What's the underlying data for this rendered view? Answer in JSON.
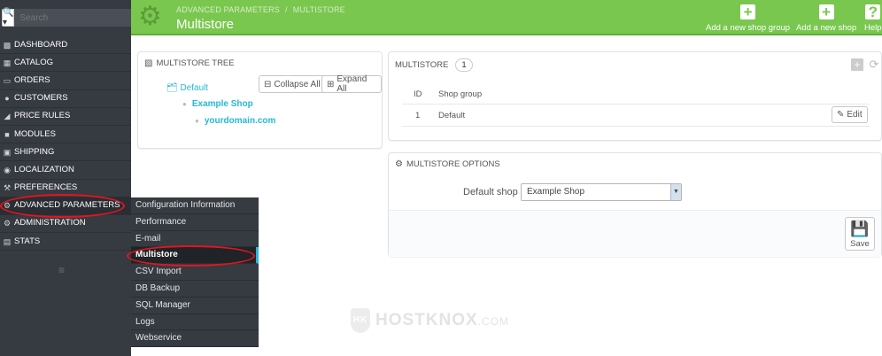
{
  "search": {
    "placeholder": "Search"
  },
  "sidebar": {
    "items": [
      {
        "label": "DASHBOARD",
        "icon": "dashboard-icon"
      },
      {
        "label": "CATALOG",
        "icon": "book-icon"
      },
      {
        "label": "ORDERS",
        "icon": "credit-card-icon"
      },
      {
        "label": "CUSTOMERS",
        "icon": "users-icon"
      },
      {
        "label": "PRICE RULES",
        "icon": "tag-icon"
      },
      {
        "label": "MODULES",
        "icon": "puzzle-icon"
      },
      {
        "label": "SHIPPING",
        "icon": "truck-icon"
      },
      {
        "label": "LOCALIZATION",
        "icon": "globe-icon"
      },
      {
        "label": "PREFERENCES",
        "icon": "wrench-icon"
      },
      {
        "label": "ADVANCED PARAMETERS",
        "icon": "cogs-icon"
      },
      {
        "label": "ADMINISTRATION",
        "icon": "cog-icon"
      },
      {
        "label": "STATS",
        "icon": "bar-chart-icon"
      }
    ],
    "submenu": [
      "Configuration Information",
      "Performance",
      "E-mail",
      "Multistore",
      "CSV Import",
      "DB Backup",
      "SQL Manager",
      "Logs",
      "Webservice"
    ]
  },
  "header": {
    "breadcrumb": [
      "ADVANCED PARAMETERS",
      "MULTISTORE"
    ],
    "breadcrumb_sep": "/",
    "title": "Multistore",
    "buttons": [
      {
        "label": "Add a new shop group",
        "icon": "plus-square-icon"
      },
      {
        "label": "Add a new shop",
        "icon": "plus-square-icon"
      },
      {
        "label": "Help",
        "icon": "help-icon"
      }
    ],
    "accent": "#7ac74f"
  },
  "tree": {
    "title": "MULTISTORE TREE",
    "collapse_label": "Collapse All",
    "expand_label": "Expand All",
    "group": "Default",
    "shop": "Example Shop",
    "url": "yourdomain.com",
    "link_color": "#25b9d7"
  },
  "multistore": {
    "title": "MULTISTORE",
    "count": "1",
    "columns": [
      "ID",
      "Shop group"
    ],
    "rows": [
      {
        "id": "1",
        "name": "Default",
        "action": "Edit"
      }
    ]
  },
  "options": {
    "title": "MULTISTORE OPTIONS",
    "default_shop_label": "Default shop",
    "default_shop_value": "Example Shop",
    "save_label": "Save"
  },
  "watermark": {
    "text": "HOSTKNOX",
    "suffix": ".COM",
    "badge": "HK"
  }
}
